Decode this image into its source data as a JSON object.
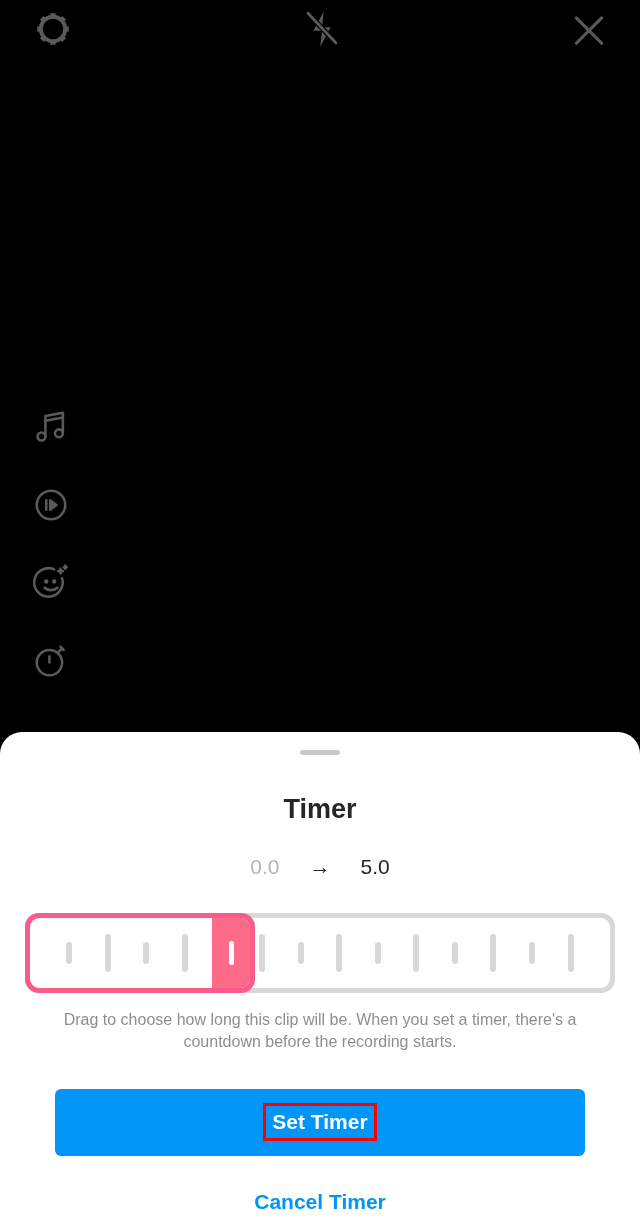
{
  "camera_toolbar": {
    "flash_on": false
  },
  "side_tools": [
    {
      "kind": "music"
    },
    {
      "kind": "play"
    },
    {
      "kind": "effects"
    },
    {
      "kind": "timer"
    }
  ],
  "sheet": {
    "title": "Timer",
    "range": {
      "start": "0.0",
      "arrow": "→",
      "end": "5.0"
    },
    "description": "Drag to choose how long this clip will be. When you set a timer, there's a countdown before the recording starts.",
    "primary_button": {
      "label": "Set Timer",
      "highlighted": true
    },
    "secondary_button": {
      "label": "Cancel Timer"
    }
  }
}
